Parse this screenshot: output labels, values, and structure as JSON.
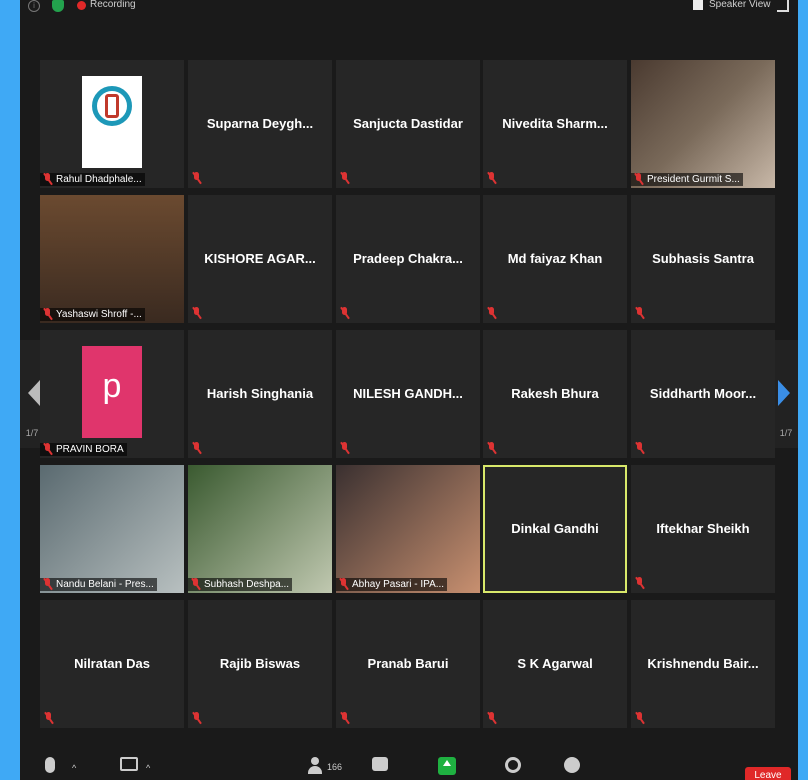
{
  "topbar": {
    "recording_label": "Recording",
    "speaker_view_label": "Speaker View"
  },
  "gallery": {
    "page_indicator": "1/7",
    "tiles": [
      {
        "name": "Rahul Dhadphale...",
        "type": "logo"
      },
      {
        "name": "Suparna  Deygh...",
        "type": "text"
      },
      {
        "name": "Sanjucta Dastidar",
        "type": "text"
      },
      {
        "name": "Nivedita  Sharm...",
        "type": "text"
      },
      {
        "name": "President Gurmit S...",
        "type": "video"
      },
      {
        "name": "Yashaswi Shroff -...",
        "type": "video"
      },
      {
        "name": "KISHORE  AGAR...",
        "type": "text"
      },
      {
        "name": "Pradeep  Chakra...",
        "type": "text"
      },
      {
        "name": "Md faiyaz Khan",
        "type": "text"
      },
      {
        "name": "Subhasis Santra",
        "type": "text"
      },
      {
        "name": "PRAVIN BORA",
        "type": "avatar",
        "initial": "p"
      },
      {
        "name": "Harish Singhania",
        "type": "text"
      },
      {
        "name": "NILESH  GANDH...",
        "type": "text"
      },
      {
        "name": "Rakesh Bhura",
        "type": "text"
      },
      {
        "name": "Siddharth  Moor...",
        "type": "text"
      },
      {
        "name": "Nandu Belani - Pres...",
        "type": "video"
      },
      {
        "name": "Subhash Deshpa...",
        "type": "video"
      },
      {
        "name": "Abhay Pasari - IPA...",
        "type": "video"
      },
      {
        "name": "Dinkal Gandhi",
        "type": "text",
        "active": true
      },
      {
        "name": "Iftekhar Sheikh",
        "type": "text"
      },
      {
        "name": "Nilratan Das",
        "type": "text"
      },
      {
        "name": "Rajib Biswas",
        "type": "text"
      },
      {
        "name": "Pranab Barui",
        "type": "text"
      },
      {
        "name": "S K Agarwal",
        "type": "text"
      },
      {
        "name": "Krishnendu  Bair...",
        "type": "text"
      }
    ]
  },
  "bottombar": {
    "participants_count": "166",
    "leave_label": "Leave"
  },
  "colors": {
    "active_speaker": "#d8e86a",
    "share_green": "#1fb141",
    "leave_red": "#e02828"
  }
}
